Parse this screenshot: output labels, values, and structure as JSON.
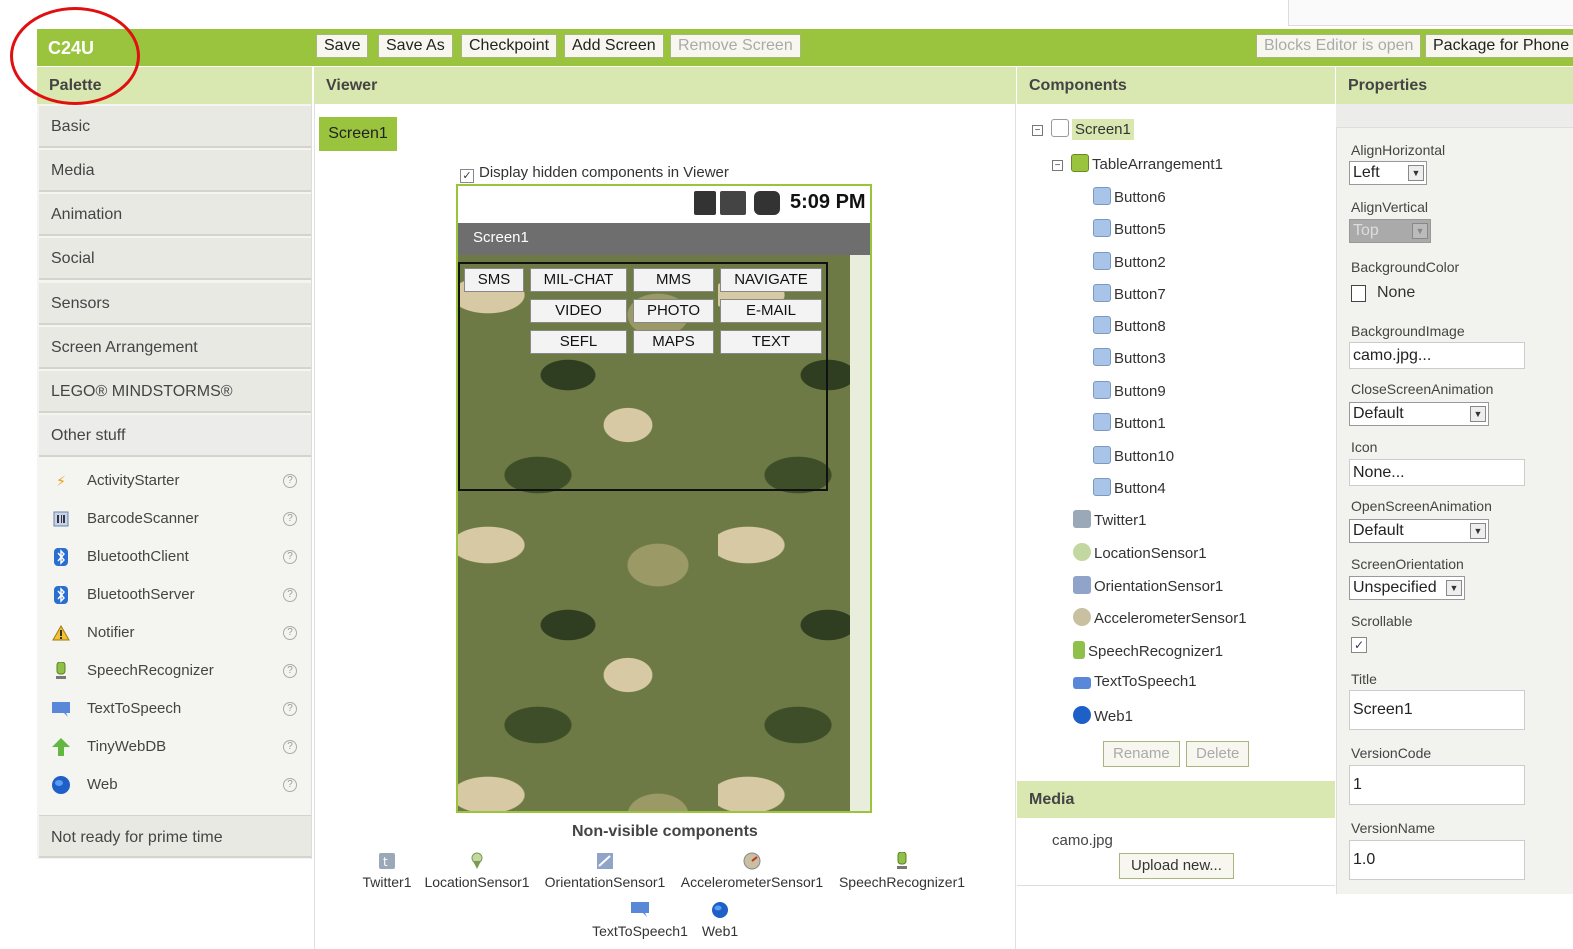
{
  "app": {
    "title": "C24U"
  },
  "toolbar": {
    "save": "Save",
    "save_as": "Save As",
    "checkpoint": "Checkpoint",
    "add_screen": "Add Screen",
    "remove_screen": "Remove Screen",
    "blocks_editor": "Blocks Editor is open",
    "package": "Package for Phone"
  },
  "palette": {
    "header": "Palette",
    "categories": [
      "Basic",
      "Media",
      "Animation",
      "Social",
      "Sensors",
      "Screen Arrangement",
      "LEGO® MINDSTORMS®",
      "Other stuff"
    ],
    "items": [
      {
        "label": "ActivityStarter",
        "icon": "lightning-icon"
      },
      {
        "label": "BarcodeScanner",
        "icon": "barcode-icon"
      },
      {
        "label": "BluetoothClient",
        "icon": "bluetooth-icon"
      },
      {
        "label": "BluetoothServer",
        "icon": "bluetooth-icon"
      },
      {
        "label": "Notifier",
        "icon": "warning-icon"
      },
      {
        "label": "SpeechRecognizer",
        "icon": "microphone-icon"
      },
      {
        "label": "TextToSpeech",
        "icon": "speech-bubble-icon"
      },
      {
        "label": "TinyWebDB",
        "icon": "up-arrow-icon"
      },
      {
        "label": "Web",
        "icon": "globe-icon"
      }
    ],
    "help_symbol": "?",
    "footer": "Not ready for prime time"
  },
  "viewer": {
    "header": "Viewer",
    "screen_tab": "Screen1",
    "display_hidden": "Display hidden components in Viewer",
    "display_hidden_checked": true,
    "status_time": "5:09 PM",
    "screen_title": "Screen1",
    "buttons_row1": [
      "SMS",
      "MIL-CHAT",
      "MMS",
      "NAVIGATE"
    ],
    "buttons_row2": [
      "VIDEO",
      "PHOTO",
      "E-MAIL"
    ],
    "buttons_row3": [
      "SEFL",
      "MAPS",
      "TEXT"
    ],
    "nonvisible_title": "Non-visible components",
    "nonvisible": [
      "Twitter1",
      "LocationSensor1",
      "OrientationSensor1",
      "AccelerometerSensor1",
      "SpeechRecognizer1",
      "TextToSpeech1",
      "Web1"
    ]
  },
  "components": {
    "header": "Components",
    "screen": "Screen1",
    "arrangement": "TableArrangement1",
    "buttons": [
      "Button6",
      "Button5",
      "Button2",
      "Button7",
      "Button8",
      "Button3",
      "Button9",
      "Button1",
      "Button10",
      "Button4"
    ],
    "others": [
      "Twitter1",
      "LocationSensor1",
      "OrientationSensor1",
      "AccelerometerSensor1",
      "SpeechRecognizer1",
      "TextToSpeech1",
      "Web1"
    ],
    "rename": "Rename",
    "delete": "Delete"
  },
  "media": {
    "header": "Media",
    "file": "camo.jpg",
    "upload": "Upload new..."
  },
  "properties": {
    "header": "Properties",
    "align_h_label": "AlignHorizontal",
    "align_h_value": "Left",
    "align_v_label": "AlignVertical",
    "align_v_value": "Top",
    "bgcolor_label": "BackgroundColor",
    "bgcolor_value": "None",
    "bgimage_label": "BackgroundImage",
    "bgimage_value": "camo.jpg...",
    "close_anim_label": "CloseScreenAnimation",
    "close_anim_value": "Default",
    "icon_label": "Icon",
    "icon_value": "None...",
    "open_anim_label": "OpenScreenAnimation",
    "open_anim_value": "Default",
    "orientation_label": "ScreenOrientation",
    "orientation_value": "Unspecified",
    "scrollable_label": "Scrollable",
    "scrollable_checked": true,
    "title_label": "Title",
    "title_value": "Screen1",
    "version_code_label": "VersionCode",
    "version_code_value": "1",
    "version_name_label": "VersionName",
    "version_name_value": "1.0"
  },
  "colors": {
    "accent": "#9ac33e",
    "header_bg": "#d9e8b0",
    "annotation": "#e01010"
  }
}
